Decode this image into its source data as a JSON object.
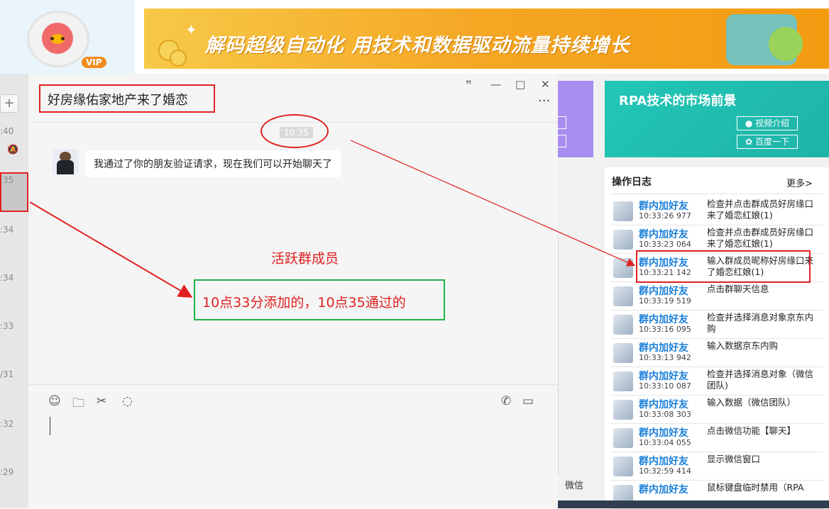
{
  "profile": {
    "badge": "VIP"
  },
  "banner": {
    "text": "解码超级自动化  用技术和数据驱动流量持续增长"
  },
  "strip": {
    "times": [
      ":40",
      ":35",
      ":34",
      ":34",
      ":33",
      "/31",
      ":32",
      ":29"
    ]
  },
  "chat": {
    "title": "好房缘佑家地产来了婚恋",
    "controls": {
      "pin": "ꟸ",
      "minimize": "—",
      "maximize": "□",
      "close": "✕",
      "more": "···"
    },
    "time_chip": "10:35",
    "message": "我通过了你的朋友验证请求，现在我们可以开始聊天了",
    "annotation_label": "活跃群成员",
    "annotation_note": "10点33分添加的，10点35通过的",
    "tools": {
      "emoji": "☺",
      "folder": "🗀",
      "scissors": "✂",
      "chat": "◌",
      "phone": "✆",
      "video": "▭"
    }
  },
  "right": {
    "promo_title": "RPA技术的市场前景",
    "promo_btn_video": "视频介绍",
    "promo_btn_search": "百度一下",
    "log_title": "操作日志",
    "log_more": "更多>",
    "wechat_label": "微信",
    "logs": [
      {
        "name": "群内加好友",
        "time": "10:33:26 977",
        "desc": "检查并点击群成员好房缘口来了婚恋红娘(1)"
      },
      {
        "name": "群内加好友",
        "time": "10:33:23 064",
        "desc": "检查并点击群成员好房缘口来了婚恋红娘(1)"
      },
      {
        "name": "群内加好友",
        "time": "10:33:21 142",
        "desc": "输入群成员昵称好房缘口来了婚恋红娘(1)"
      },
      {
        "name": "群内加好友",
        "time": "10:33:19 519",
        "desc": "点击群聊天信息"
      },
      {
        "name": "群内加好友",
        "time": "10:33:16 095",
        "desc": "检查并选择消息对象京东内购"
      },
      {
        "name": "群内加好友",
        "time": "10:33:13 942",
        "desc": "输入数据京东内购"
      },
      {
        "name": "群内加好友",
        "time": "10:33:10 087",
        "desc": "检查并选择消息对象（微信团队)"
      },
      {
        "name": "群内加好友",
        "time": "10:33:08 303",
        "desc": "输入数据（微信团队）"
      },
      {
        "name": "群内加好友",
        "time": "10:33:04 055",
        "desc": "点击微信功能【聊天】"
      },
      {
        "name": "群内加好友",
        "time": "10:32:59 414",
        "desc": "显示微信窗口"
      },
      {
        "name": "群内加好友",
        "time": "",
        "desc": "鼠标键盘临时禁用（RPA"
      }
    ]
  },
  "colors": {
    "annotation_red": "#e02020",
    "annotation_green": "#22b14c",
    "log_name_blue": "#1a7fd9",
    "teal": "#22c7b7"
  }
}
